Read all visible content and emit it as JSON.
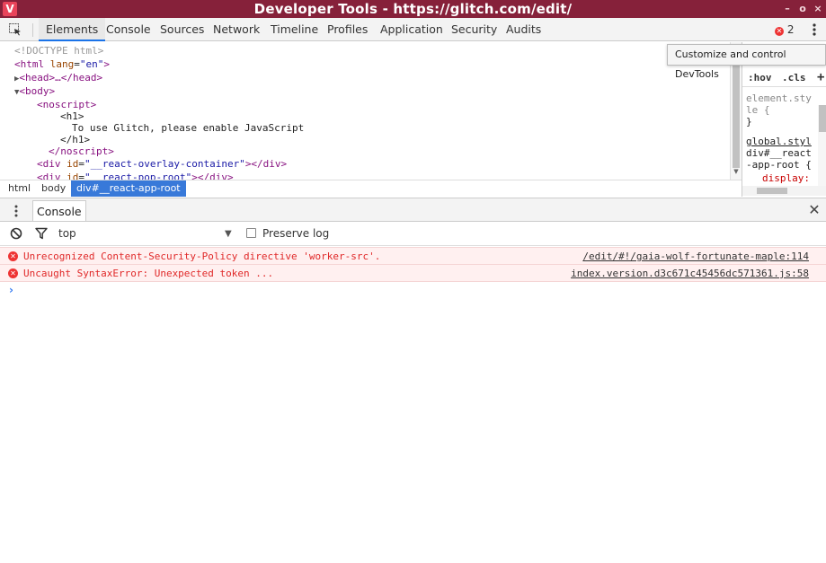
{
  "window": {
    "title": "Developer Tools - https://glitch.com/edit/",
    "logo": "V",
    "controls": [
      "–",
      "o",
      "×"
    ]
  },
  "tabs": [
    "Elements",
    "Console",
    "Sources",
    "Network",
    "Timeline",
    "Profiles",
    "Application",
    "Security",
    "Audits"
  ],
  "active_tab": "Elements",
  "error_count": "2",
  "tooltip": "Customize and control DevTools",
  "dom": {
    "doctype": "<!DOCTYPE html>",
    "html_open": "<html",
    "html_attr": "lang",
    "html_attr_val": "\"en\"",
    "head": "<head>…</head>",
    "body": "<body>",
    "noscript_open": "<noscript>",
    "h1_open": "<h1>",
    "h1_text": "To use Glitch, please enable JavaScript",
    "h1_close": "</h1>",
    "noscript_close": "</noscript>",
    "div1_id": "\"__react-overlay-container\"",
    "div2_id": "\"__react-pop-root\""
  },
  "styles": {
    "hov": ":hov",
    "cls": ".cls",
    "plus": "+",
    "element_style_1": "element.sty",
    "element_style_2": "le {",
    "close_brace": "}",
    "global": "global.styl",
    "selector_1": "div#__react",
    "selector_2": "-app-root {",
    "prop": "display:"
  },
  "breadcrumbs": [
    "html",
    "body",
    "div#__react-app-root"
  ],
  "drawer": {
    "tab": "Console",
    "context": "top",
    "preserve_log": "Preserve log"
  },
  "console_messages": [
    {
      "text": "Unrecognized Content-Security-Policy directive 'worker-src'.",
      "source": "/edit/#!/gaia-wolf-fortunate-maple:114"
    },
    {
      "text": "Uncaught SyntaxError: Unexpected token ...",
      "source": "index.version.d3c671c45456dc571361.js:58"
    }
  ],
  "prompt": "›",
  "colors": {
    "titlebar": "#86213a",
    "accent": "#1a73e8",
    "error": "#e02828",
    "selection": "#3879d9"
  }
}
